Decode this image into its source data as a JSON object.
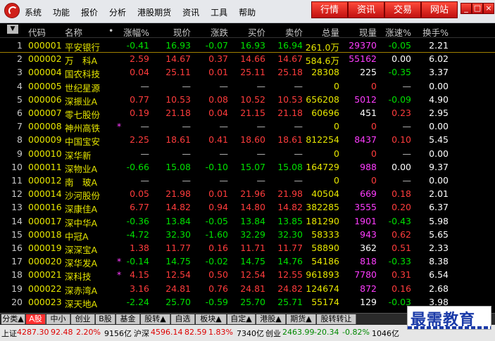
{
  "menu": [
    "系统",
    "功能",
    "报价",
    "分析",
    "港股期货",
    "资讯",
    "工具",
    "帮助"
  ],
  "top_buttons": [
    "行情",
    "资讯",
    "交易",
    "网站"
  ],
  "window_buttons": [
    "_",
    "□",
    "×"
  ],
  "columns": [
    "代码",
    "名称",
    "•",
    "涨幅%",
    "现价",
    "涨跌",
    "买价",
    "卖价",
    "总量",
    "现量",
    "涨速%",
    "换手%"
  ],
  "rows": [
    {
      "n": "1",
      "code": "000001",
      "name": "平安银行",
      "mark": "",
      "pct": "-0.41",
      "price": "16.93",
      "chg": "-0.07",
      "bid": "16.93",
      "ask": "16.94",
      "vol": "261.0万",
      "cur": "29370",
      "spd": "-0.05",
      "turn": "2.21",
      "dir": "down",
      "curc": "mag"
    },
    {
      "n": "2",
      "code": "000002",
      "name": "万　科A",
      "mark": "",
      "pct": "2.59",
      "price": "14.67",
      "chg": "0.37",
      "bid": "14.66",
      "ask": "14.67",
      "vol": "584.6万",
      "cur": "55162",
      "spd": "0.00",
      "turn": "6.02",
      "dir": "up",
      "curc": "mag"
    },
    {
      "n": "3",
      "code": "000004",
      "name": "国农科技",
      "mark": "",
      "pct": "0.04",
      "price": "25.11",
      "chg": "0.01",
      "bid": "25.11",
      "ask": "25.18",
      "vol": "28308",
      "cur": "225",
      "spd": "-0.35",
      "turn": "3.37",
      "dir": "up",
      "curc": "white"
    },
    {
      "n": "4",
      "code": "000005",
      "name": "世纪星源",
      "mark": "",
      "pct": "—",
      "price": "—",
      "chg": "—",
      "bid": "—",
      "ask": "—",
      "vol": "0",
      "cur": "0",
      "spd": "—",
      "turn": "0.00",
      "dir": "none",
      "curc": "red"
    },
    {
      "n": "5",
      "code": "000006",
      "name": "深振业A",
      "mark": "",
      "pct": "0.77",
      "price": "10.53",
      "chg": "0.08",
      "bid": "10.52",
      "ask": "10.53",
      "vol": "656208",
      "cur": "5012",
      "spd": "-0.09",
      "turn": "4.90",
      "dir": "up",
      "curc": "mag"
    },
    {
      "n": "6",
      "code": "000007",
      "name": "零七股份",
      "mark": "",
      "pct": "0.19",
      "price": "21.18",
      "chg": "0.04",
      "bid": "21.15",
      "ask": "21.18",
      "vol": "60696",
      "cur": "451",
      "spd": "0.23",
      "turn": "2.95",
      "dir": "up",
      "curc": "white"
    },
    {
      "n": "7",
      "code": "000008",
      "name": "神州高铁",
      "mark": "*",
      "pct": "—",
      "price": "—",
      "chg": "—",
      "bid": "—",
      "ask": "—",
      "vol": "0",
      "cur": "0",
      "spd": "—",
      "turn": "0.00",
      "dir": "none",
      "curc": "red"
    },
    {
      "n": "8",
      "code": "000009",
      "name": "中国宝安",
      "mark": "",
      "pct": "2.25",
      "price": "18.61",
      "chg": "0.41",
      "bid": "18.60",
      "ask": "18.61",
      "vol": "812254",
      "cur": "8437",
      "spd": "0.10",
      "turn": "5.45",
      "dir": "up",
      "curc": "mag"
    },
    {
      "n": "9",
      "code": "000010",
      "name": "深华新",
      "mark": "",
      "pct": "—",
      "price": "—",
      "chg": "—",
      "bid": "—",
      "ask": "—",
      "vol": "0",
      "cur": "0",
      "spd": "—",
      "turn": "0.00",
      "dir": "none",
      "curc": "red"
    },
    {
      "n": "10",
      "code": "000011",
      "name": "深物业A",
      "mark": "",
      "pct": "-0.66",
      "price": "15.08",
      "chg": "-0.10",
      "bid": "15.07",
      "ask": "15.08",
      "vol": "164729",
      "cur": "988",
      "spd": "0.00",
      "turn": "9.37",
      "dir": "down",
      "curc": "mag"
    },
    {
      "n": "11",
      "code": "000012",
      "name": "南　玻A",
      "mark": "",
      "pct": "—",
      "price": "—",
      "chg": "—",
      "bid": "—",
      "ask": "—",
      "vol": "0",
      "cur": "0",
      "spd": "—",
      "turn": "0.00",
      "dir": "none",
      "curc": "red"
    },
    {
      "n": "12",
      "code": "000014",
      "name": "沙河股份",
      "mark": "",
      "pct": "0.05",
      "price": "21.98",
      "chg": "0.01",
      "bid": "21.96",
      "ask": "21.98",
      "vol": "40504",
      "cur": "669",
      "spd": "0.18",
      "turn": "2.01",
      "dir": "up",
      "curc": "mag"
    },
    {
      "n": "13",
      "code": "000016",
      "name": "深康佳A",
      "mark": "",
      "pct": "6.77",
      "price": "14.82",
      "chg": "0.94",
      "bid": "14.80",
      "ask": "14.82",
      "vol": "382285",
      "cur": "3555",
      "spd": "0.20",
      "turn": "6.37",
      "dir": "up",
      "curc": "mag"
    },
    {
      "n": "14",
      "code": "000017",
      "name": "深中华A",
      "mark": "",
      "pct": "-0.36",
      "price": "13.84",
      "chg": "-0.05",
      "bid": "13.84",
      "ask": "13.85",
      "vol": "181290",
      "cur": "1901",
      "spd": "-0.43",
      "turn": "5.98",
      "dir": "down",
      "curc": "mag"
    },
    {
      "n": "15",
      "code": "000018",
      "name": "中冠A",
      "mark": "",
      "pct": "-4.72",
      "price": "32.30",
      "chg": "-1.60",
      "bid": "32.29",
      "ask": "32.30",
      "vol": "58333",
      "cur": "943",
      "spd": "0.62",
      "turn": "5.65",
      "dir": "down",
      "curc": "mag"
    },
    {
      "n": "16",
      "code": "000019",
      "name": "深深宝A",
      "mark": "",
      "pct": "1.38",
      "price": "11.77",
      "chg": "0.16",
      "bid": "11.71",
      "ask": "11.77",
      "vol": "58890",
      "cur": "362",
      "spd": "0.51",
      "turn": "2.33",
      "dir": "up",
      "curc": "white"
    },
    {
      "n": "17",
      "code": "000020",
      "name": "深华发A",
      "mark": "*",
      "pct": "-0.14",
      "price": "14.75",
      "chg": "-0.02",
      "bid": "14.75",
      "ask": "14.76",
      "vol": "54186",
      "cur": "818",
      "spd": "-0.33",
      "turn": "8.38",
      "dir": "down",
      "curc": "mag"
    },
    {
      "n": "18",
      "code": "000021",
      "name": "深科技",
      "mark": "*",
      "pct": "4.15",
      "price": "12.54",
      "chg": "0.50",
      "bid": "12.54",
      "ask": "12.55",
      "vol": "961893",
      "cur": "7780",
      "spd": "0.31",
      "turn": "6.54",
      "dir": "up",
      "curc": "mag"
    },
    {
      "n": "19",
      "code": "000022",
      "name": "深赤湾A",
      "mark": "",
      "pct": "3.16",
      "price": "24.81",
      "chg": "0.76",
      "bid": "24.81",
      "ask": "24.82",
      "vol": "124674",
      "cur": "872",
      "spd": "0.16",
      "turn": "2.68",
      "dir": "up",
      "curc": "mag"
    },
    {
      "n": "20",
      "code": "000023",
      "name": "深天地A",
      "mark": "",
      "pct": "-2.24",
      "price": "25.70",
      "chg": "-0.59",
      "bid": "25.70",
      "ask": "25.71",
      "vol": "55174",
      "cur": "129",
      "spd": "-0.03",
      "turn": "3.98",
      "dir": "down",
      "curc": "white"
    }
  ],
  "tabs": [
    "分类▲",
    "A股",
    "中小",
    "创业",
    "B股",
    "基金",
    "股转▲",
    "自选",
    "板块▲",
    "自定▲",
    "港股▲",
    "期货▲",
    "股转转让"
  ],
  "status": {
    "sh_label": "上证",
    "sh_idx": "4287.30",
    "sh_chg": "92.48",
    "sh_pct": "2.20%",
    "sh_amt": "9156亿",
    "hs_label": "沪深",
    "hs_idx": "4596.14",
    "hs_chg": "82.59",
    "hs_pct": "1.83%",
    "hs_amt": "7340亿",
    "cy_label": "创业",
    "cy_idx": "2463.99",
    "cy_chg": "-20.34",
    "cy_pct": "-0.82%",
    "cy_amt": "1046亿"
  },
  "watermark": "最需教育",
  "colors": {
    "up": "#ff3c3c",
    "down": "#00e000",
    "neutral": "#ffffff",
    "code": "#e6e600",
    "name": "#e6e600",
    "mag": "#ff3cff",
    "dash": "#c0c0c0"
  }
}
